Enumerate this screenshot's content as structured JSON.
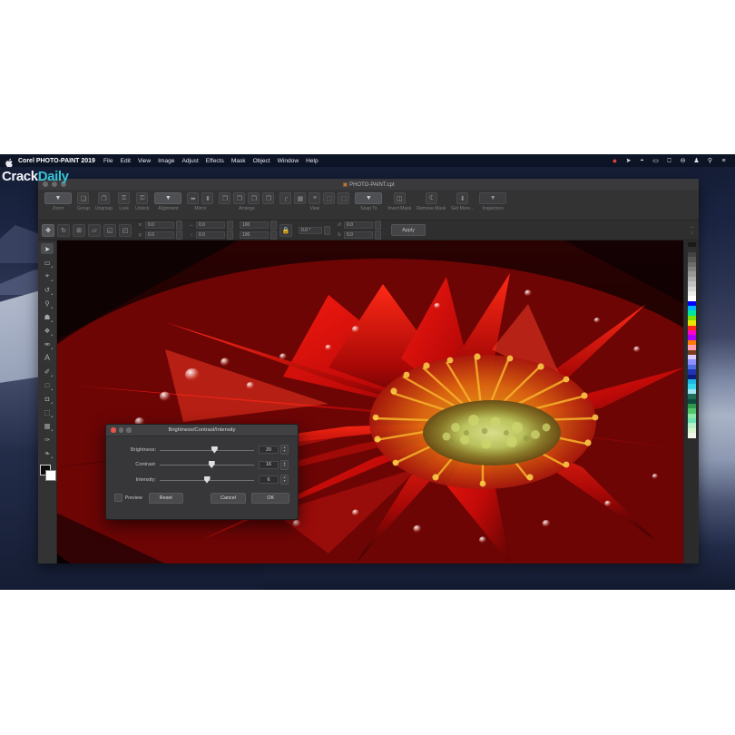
{
  "watermark": {
    "part1": "Crack",
    "part2": "Daily"
  },
  "menubar": {
    "apple_icon": "apple-icon",
    "app_name": "Corel PHOTO-PAINT 2019",
    "items": [
      {
        "label": "File"
      },
      {
        "label": "Edit"
      },
      {
        "label": "View"
      },
      {
        "label": "Image"
      },
      {
        "label": "Adjust"
      },
      {
        "label": "Effects"
      },
      {
        "label": "Mask"
      },
      {
        "label": "Object"
      },
      {
        "label": "Window"
      },
      {
        "label": "Help"
      }
    ],
    "status_icons": [
      {
        "name": "notification-badge-icon",
        "glyph": "●"
      },
      {
        "name": "location-arrow-icon",
        "glyph": "➤"
      },
      {
        "name": "wifi-icon",
        "glyph": "▲"
      },
      {
        "name": "battery-icon",
        "glyph": "▭"
      },
      {
        "name": "airplay-display-icon",
        "glyph": "▭"
      },
      {
        "name": "control-center-icon",
        "glyph": "⊖"
      },
      {
        "name": "user-account-icon",
        "glyph": "☰"
      },
      {
        "name": "search-icon",
        "glyph": "⚲"
      },
      {
        "name": "notification-list-icon",
        "glyph": "≡"
      }
    ]
  },
  "window": {
    "document_title": "PHOTO-PAINT.cpt",
    "document_icon": "document-icon"
  },
  "toolbar": {
    "groups": [
      {
        "label": "Zoom",
        "buttons": [
          {
            "name": "zoom-level-dropdown",
            "glyph": "▼",
            "wide": true,
            "selected": true
          }
        ]
      },
      {
        "label": "Group",
        "buttons": [
          {
            "name": "group-button",
            "glyph": "❑"
          }
        ]
      },
      {
        "label": "Ungroup",
        "buttons": [
          {
            "name": "ungroup-button",
            "glyph": "❐"
          }
        ]
      },
      {
        "label": "Lock",
        "buttons": [
          {
            "name": "lock-button",
            "glyph": "⚿"
          }
        ]
      },
      {
        "label": "Unlock",
        "buttons": [
          {
            "name": "unlock-button",
            "glyph": "⚿"
          }
        ]
      },
      {
        "label": "Alignment",
        "buttons": [
          {
            "name": "alignment-dropdown",
            "glyph": "▼",
            "wide": true,
            "selected": true
          }
        ]
      },
      {
        "label": "Mirror",
        "buttons": [
          {
            "name": "mirror-horizontal-button",
            "glyph": "⬌"
          },
          {
            "name": "mirror-vertical-button",
            "glyph": "⬍"
          }
        ]
      },
      {
        "label": "Arrange",
        "buttons": [
          {
            "name": "arrange-front-button",
            "glyph": "❐"
          },
          {
            "name": "arrange-forward-button",
            "glyph": "❐"
          },
          {
            "name": "arrange-back-button",
            "glyph": "❐"
          },
          {
            "name": "arrange-backward-button",
            "glyph": "❐"
          }
        ]
      },
      {
        "label": "View",
        "buttons": [
          {
            "name": "view-rulers-button",
            "glyph": "┌"
          },
          {
            "name": "view-grid-button",
            "glyph": "▦"
          },
          {
            "name": "view-guidelines-button",
            "glyph": "≡"
          },
          {
            "name": "view-page-button",
            "glyph": "⬚"
          },
          {
            "name": "view-frame-button",
            "glyph": "⬚"
          }
        ]
      },
      {
        "label": "Snap To",
        "buttons": [
          {
            "name": "snap-to-dropdown",
            "glyph": "▼",
            "wide": true,
            "selected": true
          }
        ]
      },
      {
        "label": "Invert Mask",
        "buttons": [
          {
            "name": "invert-mask-button",
            "glyph": "◫"
          }
        ]
      },
      {
        "label": "Remove Mask",
        "buttons": [
          {
            "name": "remove-mask-button",
            "glyph": "⌧"
          }
        ]
      },
      {
        "label": "Get More...",
        "buttons": [
          {
            "name": "get-more-button",
            "glyph": "⬇"
          }
        ]
      },
      {
        "label": "Inspectors",
        "buttons": [
          {
            "name": "inspectors-dropdown",
            "glyph": "▼",
            "wide": true
          }
        ]
      }
    ]
  },
  "propertybar": {
    "mode_icons": [
      {
        "name": "move-tool-icon",
        "glyph": "✥",
        "active": true
      },
      {
        "name": "rotate-tool-icon",
        "glyph": "↻"
      },
      {
        "name": "scale-tool-icon",
        "glyph": "⊞"
      },
      {
        "name": "skew-tool-icon",
        "glyph": "▱"
      },
      {
        "name": "distort-tool-icon",
        "glyph": "◱"
      },
      {
        "name": "perspective-tool-icon",
        "glyph": "◰"
      }
    ],
    "position": {
      "x_label": "x:",
      "x_value": "0.0",
      "y_label": "y:",
      "y_value": "0.0"
    },
    "size": {
      "w_label": "↔",
      "w_value": "0.0",
      "h_label": "↕",
      "h_value": "0.0"
    },
    "scale": {
      "w_value": "100",
      "h_value": "100"
    },
    "rotation": {
      "value": "0.0 °"
    },
    "skew": {
      "x_value": "0.0",
      "y_value": "0.0"
    },
    "apply_label": "Apply"
  },
  "toolbox": {
    "tools": [
      {
        "name": "pick-tool",
        "glyph": "➤",
        "selected": true,
        "flyout": false
      },
      {
        "name": "rectangle-mask-tool",
        "glyph": "▭",
        "selected": false,
        "flyout": true
      },
      {
        "name": "crop-tool",
        "glyph": "⌖",
        "selected": false,
        "flyout": true
      },
      {
        "name": "transform-tool",
        "glyph": "↺",
        "selected": false,
        "flyout": true
      },
      {
        "name": "zoom-tool",
        "glyph": "⚲",
        "selected": false,
        "flyout": true
      },
      {
        "name": "clone-tool",
        "glyph": "⚗",
        "selected": false,
        "flyout": true
      },
      {
        "name": "effect-tool",
        "glyph": "❖",
        "selected": false,
        "flyout": true
      },
      {
        "name": "eyedropper-tool",
        "glyph": "☂",
        "selected": false,
        "flyout": true
      },
      {
        "name": "text-tool",
        "glyph": "A",
        "selected": false,
        "flyout": false
      },
      {
        "name": "paint-brush-tool",
        "glyph": "✐",
        "selected": false,
        "flyout": true
      },
      {
        "name": "rectangle-shape-tool",
        "glyph": "□",
        "selected": false,
        "flyout": true
      },
      {
        "name": "eraser-tool",
        "glyph": "◘",
        "selected": false,
        "flyout": true
      },
      {
        "name": "fill-tool",
        "glyph": "⬚",
        "selected": false,
        "flyout": true
      },
      {
        "name": "pattern-fill-tool",
        "glyph": "▦",
        "selected": false,
        "flyout": true
      },
      {
        "name": "smudge-tool",
        "glyph": "✑",
        "selected": false,
        "flyout": false
      },
      {
        "name": "dropper-tool",
        "glyph": "❧",
        "selected": false,
        "flyout": true
      }
    ],
    "foreground_color": "#0c0c0c",
    "background_color": "#ffffff"
  },
  "palette": {
    "colors": [
      "#1a1a1a",
      "#2e2e2e",
      "#434343",
      "#585858",
      "#6d6d6d",
      "#828282",
      "#979797",
      "#acacac",
      "#c1c1c1",
      "#d6d6d6",
      "#ebebeb",
      "#ffffff",
      "#0000ff",
      "#00b4ff",
      "#00e5a0",
      "#7fe000",
      "#e8e800",
      "#ff2a1a",
      "#ff00c8",
      "#aa00ff",
      "#ff7a00",
      "#ff9fb0",
      "#7a3b1e",
      "#d8c9ff",
      "#8f8fff",
      "#4f6fe0",
      "#2233b0",
      "#0a1a80",
      "#1fb6e0",
      "#37d6ef",
      "#9fe6f2",
      "#1f6b5a",
      "#0f4a3c",
      "#2f9a4e",
      "#52c46a",
      "#8ce8a6",
      "#6fe0b0",
      "#b6f0c8",
      "#d9f5d0",
      "#f0f7e8"
    ]
  },
  "dialog": {
    "title": "Brightness/Contrast/Intensity",
    "close_icon": "close-icon",
    "minimize_icon": "minimize-icon",
    "maximize_icon": "maximize-icon",
    "sliders": [
      {
        "label": "Brightness:",
        "value": "20",
        "pct": 58
      },
      {
        "label": "Contrast:",
        "value": "16",
        "pct": 55
      },
      {
        "label": "Intensity:",
        "value": "6",
        "pct": 50
      }
    ],
    "preview_label": "Preview",
    "preview_checked": false,
    "reset_label": "Reset",
    "cancel_label": "Cancel",
    "ok_label": "OK"
  }
}
